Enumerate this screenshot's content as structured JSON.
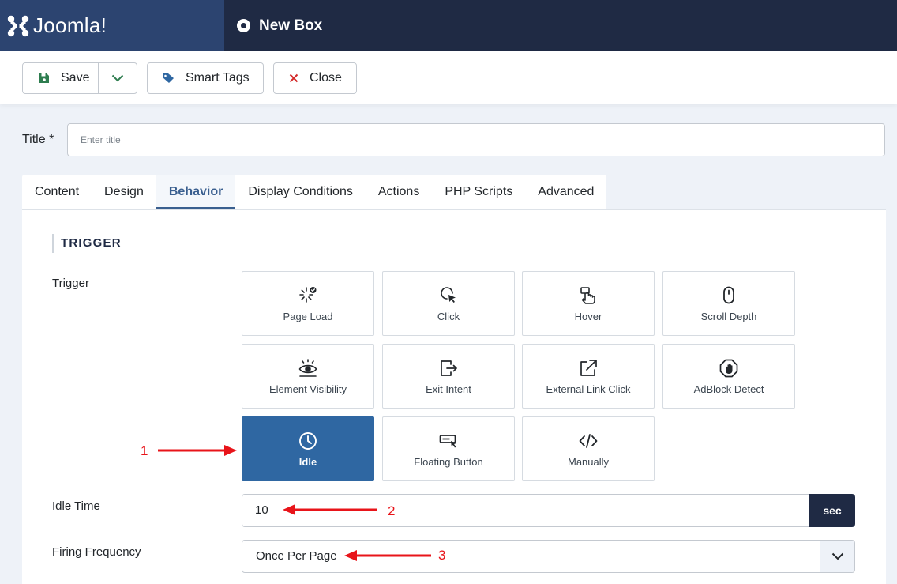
{
  "header": {
    "logo_text": "Joomla!",
    "page_title": "New Box"
  },
  "toolbar": {
    "save_label": "Save",
    "smart_tags_label": "Smart Tags",
    "close_label": "Close"
  },
  "title_field": {
    "label": "Title *",
    "placeholder": "Enter title"
  },
  "tabs": [
    {
      "label": "Content",
      "active": false
    },
    {
      "label": "Design",
      "active": false
    },
    {
      "label": "Behavior",
      "active": true
    },
    {
      "label": "Display Conditions",
      "active": false
    },
    {
      "label": "Actions",
      "active": false
    },
    {
      "label": "PHP Scripts",
      "active": false
    },
    {
      "label": "Advanced",
      "active": false
    }
  ],
  "behavior": {
    "section_title": "TRIGGER",
    "trigger_label": "Trigger",
    "triggers": [
      {
        "label": "Page Load",
        "icon": "page-load-icon",
        "selected": false
      },
      {
        "label": "Click",
        "icon": "click-icon",
        "selected": false
      },
      {
        "label": "Hover",
        "icon": "hover-icon",
        "selected": false
      },
      {
        "label": "Scroll Depth",
        "icon": "mouse-scroll-icon",
        "selected": false
      },
      {
        "label": "Element Visibility",
        "icon": "eye-icon",
        "selected": false
      },
      {
        "label": "Exit Intent",
        "icon": "exit-icon",
        "selected": false
      },
      {
        "label": "External Link Click",
        "icon": "external-link-icon",
        "selected": false
      },
      {
        "label": "AdBlock Detect",
        "icon": "stop-hand-icon",
        "selected": false
      },
      {
        "label": "Idle",
        "icon": "clock-icon",
        "selected": true
      },
      {
        "label": "Floating Button",
        "icon": "floating-button-icon",
        "selected": false
      },
      {
        "label": "Manually",
        "icon": "code-icon",
        "selected": false
      }
    ],
    "idle_time_label": "Idle Time",
    "idle_time_value": "10",
    "idle_time_unit": "sec",
    "firing_frequency_label": "Firing Frequency",
    "firing_frequency_value": "Once Per Page"
  },
  "annotations": [
    "1",
    "2",
    "3"
  ],
  "colors": {
    "header_bg": "#1f2a44",
    "logo_bg": "#2c4470",
    "accent": "#3a5f8f",
    "selected_card": "#2f67a2",
    "annotation": "#e8141a"
  }
}
